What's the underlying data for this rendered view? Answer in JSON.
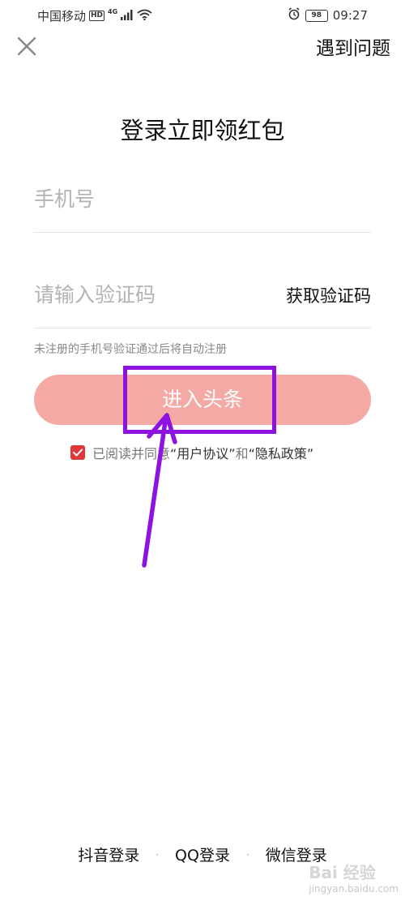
{
  "status_bar": {
    "carrier": "中国移动",
    "hd": "HD",
    "network": "4G",
    "battery": "98",
    "time": "09:27"
  },
  "header": {
    "close_icon": "close-icon",
    "help_label": "遇到问题"
  },
  "title": "登录立即领红包",
  "form": {
    "phone_placeholder": "手机号",
    "code_placeholder": "请输入验证码",
    "get_code_label": "获取验证码",
    "hint": "未注册的手机号验证通过后将自动注册",
    "submit_label": "进入头条"
  },
  "agreement": {
    "checked": true,
    "prefix": "已阅读并同意",
    "user_agreement": "“用户协议”",
    "and": "和",
    "privacy_policy": "“隐私政策”"
  },
  "other_logins": {
    "douyin": "抖音登录",
    "separator": "·",
    "qq": "QQ登录",
    "wechat": "微信登录"
  },
  "annotation": {
    "color": "#8e12e0"
  },
  "colors": {
    "submit_bg": "#f5a9a5",
    "checkbox": "#e0393b"
  },
  "watermark": {
    "logo": "Bai 经验",
    "url": "jingyan.baidu.com"
  }
}
